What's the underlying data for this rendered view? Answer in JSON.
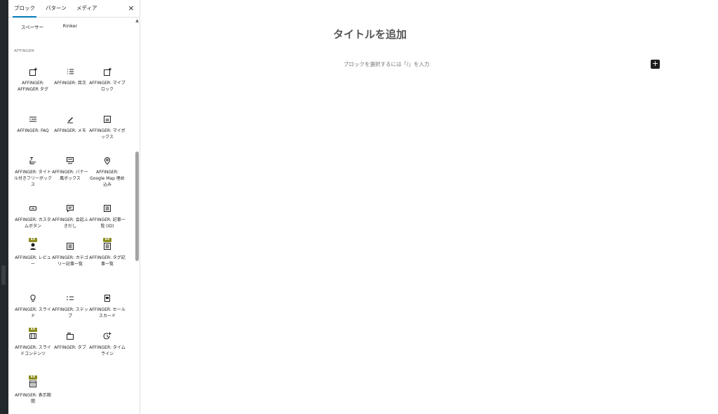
{
  "inserter": {
    "tabs": [
      {
        "label": "ブロック"
      },
      {
        "label": "パターン"
      },
      {
        "label": "メディア"
      }
    ],
    "close_glyph": "×",
    "top_items": [
      {
        "label": "スペーサー"
      },
      {
        "label": "Rinker"
      }
    ],
    "section_heading": "AFFINGER",
    "pro_badge": "EX",
    "blocks": [
      {
        "label": "AFFINGER: AFFINGER タグ",
        "icon": "tag-block-icon",
        "pro": false
      },
      {
        "label": "AFFINGER: 目次",
        "icon": "list-icon",
        "pro": false
      },
      {
        "label": "AFFINGER: マイブロック",
        "icon": "myblock-icon",
        "pro": false
      },
      {
        "label": "AFFINGER: FAQ",
        "icon": "faq-icon",
        "pro": false
      },
      {
        "label": "AFFINGER: メモ",
        "icon": "pen-icon",
        "pro": false
      },
      {
        "label": "AFFINGER: マイボックス",
        "icon": "box-icon",
        "pro": false
      },
      {
        "label": "AFFINGER: タイトル付きフリーボックス",
        "icon": "titled-box-icon",
        "pro": false
      },
      {
        "label": "AFFINGER: バナー風ボックス",
        "icon": "banner-icon",
        "pro": false
      },
      {
        "label": "AFFINGER: Google Map 埋め込み",
        "icon": "map-pin-icon",
        "pro": false
      },
      {
        "label": "AFFINGER: カスタムボタン",
        "icon": "button-icon",
        "pro": false
      },
      {
        "label": "AFFINGER: 会話ふきだし",
        "icon": "speech-bubble-icon",
        "pro": false
      },
      {
        "label": "AFFINGER: 記事一覧 (ID)",
        "icon": "post-list-icon",
        "pro": false
      },
      {
        "label": "AFFINGER: レビュー",
        "icon": "review-icon",
        "pro": true
      },
      {
        "label": "AFFINGER: カテゴリー記事一覧",
        "icon": "category-list-icon",
        "pro": false
      },
      {
        "label": "AFFINGER: タグ記事一覧",
        "icon": "tag-list-icon",
        "pro": true
      },
      {
        "label": "AFFINGER: スライド",
        "icon": "lightbulb-icon",
        "pro": false
      },
      {
        "label": "AFFINGER: ステップ",
        "icon": "steps-icon",
        "pro": false
      },
      {
        "label": "AFFINGER: セールスカード",
        "icon": "sales-card-icon",
        "pro": false
      },
      {
        "label": "AFFINGER: スライドコンテンツ",
        "icon": "slide-content-icon",
        "pro": true
      },
      {
        "label": "AFFINGER: タブ",
        "icon": "tab-icon",
        "pro": false
      },
      {
        "label": "AFFINGER: タイムライン",
        "icon": "timeline-icon",
        "pro": false
      },
      {
        "label": "AFFINGER: 表示期間",
        "icon": "calendar-icon",
        "pro": true
      }
    ]
  },
  "editor": {
    "title_placeholder": "タイトルを追加",
    "block_placeholder": "ブロックを選択するには「/」を入力",
    "add_block_glyph": "+"
  }
}
